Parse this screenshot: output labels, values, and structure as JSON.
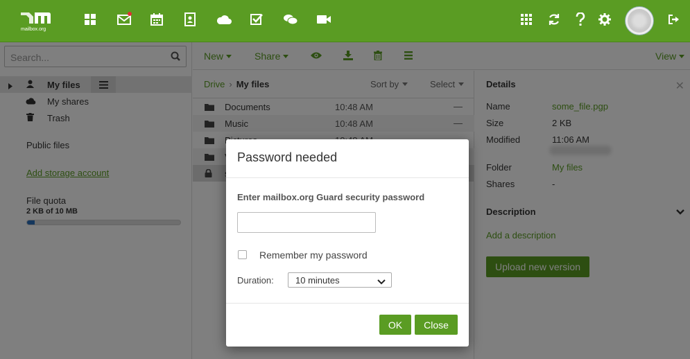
{
  "brand": {
    "logo_mark": "m",
    "logo_sub": "mailbox.org",
    "accent": "#5a9c23",
    "header_bg": "#5a9c23"
  },
  "topbar": {
    "apps": [
      {
        "name": "portal-icon"
      },
      {
        "name": "mail-icon",
        "badge": true
      },
      {
        "name": "calendar-icon"
      },
      {
        "name": "address-book-icon"
      },
      {
        "name": "drive-icon"
      },
      {
        "name": "tasks-icon"
      },
      {
        "name": "chat-icon"
      },
      {
        "name": "video-icon"
      }
    ],
    "right_icons": [
      "apps-grid-icon",
      "refresh-icon",
      "help-icon",
      "settings-icon",
      "avatar",
      "logout-icon"
    ]
  },
  "sidebar": {
    "search_placeholder": "Search...",
    "tree": [
      {
        "label": "My files",
        "icon": "user-icon",
        "active": true
      },
      {
        "label": "My shares",
        "icon": "cloud-icon"
      },
      {
        "label": "Trash",
        "icon": "trash-icon"
      }
    ],
    "public_files": "Public files",
    "add_storage": "Add storage account",
    "quota_title": "File quota",
    "quota_text": "2 KB of 10 MB",
    "quota_fraction": 0.05
  },
  "toolbar": {
    "new_label": "New",
    "share_label": "Share",
    "view_label": "View",
    "icons": [
      "view-eye-icon",
      "download-icon",
      "delete-icon",
      "more-icon"
    ]
  },
  "list": {
    "breadcrumb": {
      "root": "Drive",
      "separator": "›",
      "current": "My files"
    },
    "sort_label": "Sort by",
    "select_label": "Select",
    "rows": [
      {
        "name": "Documents",
        "time": "10:48 AM",
        "size": "—",
        "icon": "folder-icon"
      },
      {
        "name": "Music",
        "time": "10:48 AM",
        "size": "—",
        "icon": "folder-icon"
      },
      {
        "name": "Pictures",
        "time": "10:48 AM",
        "size": "—",
        "icon": "folder-icon"
      },
      {
        "name": "V",
        "time": "",
        "size": "",
        "icon": "folder-icon"
      },
      {
        "name": "s",
        "time": "",
        "size": "",
        "icon": "lock-icon"
      }
    ]
  },
  "details": {
    "title": "Details",
    "fields": [
      {
        "label": "Name",
        "value": "some_file.pgp",
        "link": true
      },
      {
        "label": "Size",
        "value": "2 KB"
      },
      {
        "label": "Modified",
        "value": "11:06 AM"
      },
      {
        "label": "Folder",
        "value": "My files",
        "link": true
      },
      {
        "label": "Shares",
        "value": "-"
      }
    ],
    "description_title": "Description",
    "add_description": "Add a description",
    "upload_label": "Upload new version"
  },
  "modal": {
    "title": "Password needed",
    "prompt": "Enter mailbox.org Guard security password",
    "password_value": "",
    "remember_label": "Remember my password",
    "remember_checked": false,
    "duration_label": "Duration:",
    "duration_value": "10 minutes",
    "ok_label": "OK",
    "close_label": "Close"
  }
}
